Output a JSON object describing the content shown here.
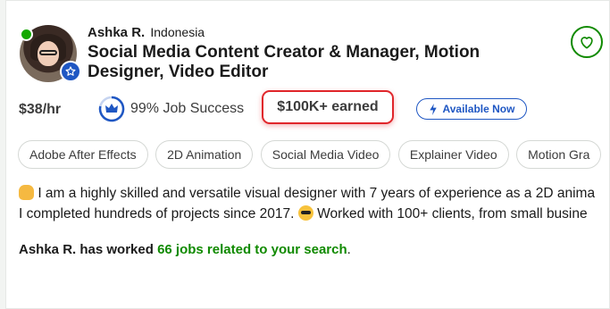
{
  "freelancer": {
    "name": "Ashka R.",
    "country": "Indonesia",
    "title": "Social Media Content Creator & Manager, Motion Designer, Video Editor",
    "online": true,
    "verified": true
  },
  "stats": {
    "rate": "$38/hr",
    "job_success": "99% Job Success",
    "earned": "$100K+ earned",
    "availability": "Available Now"
  },
  "skills": [
    "Adobe After Effects",
    "2D Animation",
    "Social Media Video",
    "Explainer Video",
    "Motion Gra"
  ],
  "bio": {
    "line1": "I am a highly skilled and versatile visual designer with 7 years of experience as a 2D anima",
    "line2_a": "I completed hundreds of projects since 2017.",
    "line2_b": "Worked with 100+ clients, from small busine"
  },
  "worked": {
    "prefix": "Ashka R. has worked",
    "link": "66 jobs related to your search",
    "suffix": "."
  },
  "colors": {
    "brand_green": "#108a00",
    "online_green": "#14a800",
    "blue": "#1f57c3",
    "highlight_red": "#e0262b"
  },
  "icons": [
    "heart-icon",
    "crown-icon",
    "lightning-icon",
    "verified-star-icon",
    "raised-hands-emoji",
    "sunglasses-emoji"
  ]
}
